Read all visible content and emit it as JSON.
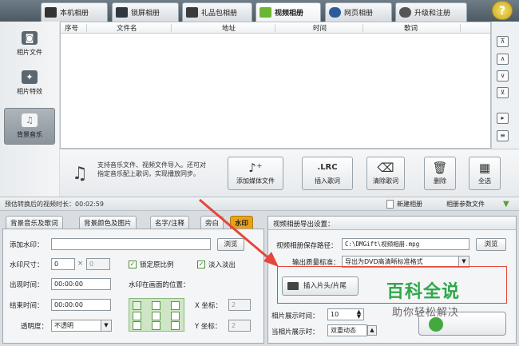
{
  "top_tabs": [
    {
      "label": "本机相册",
      "icon": "camera-icon",
      "active": false
    },
    {
      "label": "锁屏相册",
      "icon": "monitor-icon",
      "active": false
    },
    {
      "label": "礼品包相册",
      "icon": "gift-icon",
      "active": false
    },
    {
      "label": "视频相册",
      "icon": "film-icon",
      "active": true
    },
    {
      "label": "网页相册",
      "icon": "ie-icon",
      "active": false
    },
    {
      "label": "升级和注册",
      "icon": "upgrade-icon",
      "active": false
    }
  ],
  "sidebar": {
    "items": [
      {
        "label": "相片文件",
        "icon": "camera-icon"
      },
      {
        "label": "相片特效",
        "icon": "effects-icon"
      },
      {
        "label": "背景音乐",
        "icon": "music-note-icon"
      }
    ]
  },
  "list": {
    "columns": [
      "序号",
      "文件名",
      "地址",
      "时间",
      "歌词"
    ]
  },
  "action": {
    "note": "支持音乐文件、视频文件导入。还可对指定音乐配上歌词，实现播放同步。",
    "buttons": [
      {
        "label": "添加媒体文件",
        "icon": "add-music-icon",
        "glyph": "♪⁺"
      },
      {
        "label": "插入歌词",
        "icon": "lrc-icon",
        "glyph": ".LRC"
      },
      {
        "label": "清除歌词",
        "icon": "clear-lyric-icon",
        "glyph": "⌫"
      },
      {
        "label": "删除",
        "icon": "trash-icon",
        "glyph": "🗑"
      },
      {
        "label": "全选",
        "icon": "select-all-icon",
        "glyph": "▦"
      }
    ]
  },
  "status": {
    "duration_label": "预估转换后的视频时长：",
    "duration_value": "00:02:59",
    "new_album": "新建相册",
    "params": "相册参数文件"
  },
  "left_panel": {
    "tabs": [
      "背景音乐及歌词",
      "背景颜色及图片",
      "名字/注释",
      "旁白",
      "水印"
    ],
    "add_watermark_label": "添加水印：",
    "add_watermark_value": "",
    "browse": "浏览",
    "size_label": "水印尺寸：",
    "size_w": "0",
    "size_x": "×",
    "size_h": "0",
    "lock_ratio": "锁定原比例",
    "fade": "淡入淡出",
    "appear_label": "出现时间：",
    "appear_value": "00:00:00",
    "position_label": "水印在画面的位置：",
    "end_label": "结束时间：",
    "end_value": "00:00:00",
    "x_label": "X 坐标：",
    "x_value": "2",
    "y_label": "Y 坐标：",
    "y_value": "2",
    "opacity_label": "透明度：",
    "opacity_value": "不透明"
  },
  "right_panel": {
    "title": "视频相册导出设置：",
    "save_path_label": "视频相册保存路径：",
    "save_path_value": "C:\\DMGift\\视频相册.mpg",
    "browse": "浏览",
    "quality_label": "输出质量标准：",
    "quality_value": "导出为DVD高清晰标准格式",
    "insert_button": "插入片头/片尾",
    "photo_time_label": "相片展示时间：",
    "photo_time_value": "10",
    "current_label": "当相片展示时：",
    "current_value": "双重动态"
  },
  "watermark": {
    "line1": "百科全说",
    "line2": "助你轻松解决"
  },
  "colors": {
    "accent_tab": "#e9a31a",
    "highlight_box": "#e4473d",
    "arrow": "#e4473d",
    "watermark_green": "#2ea84a"
  }
}
